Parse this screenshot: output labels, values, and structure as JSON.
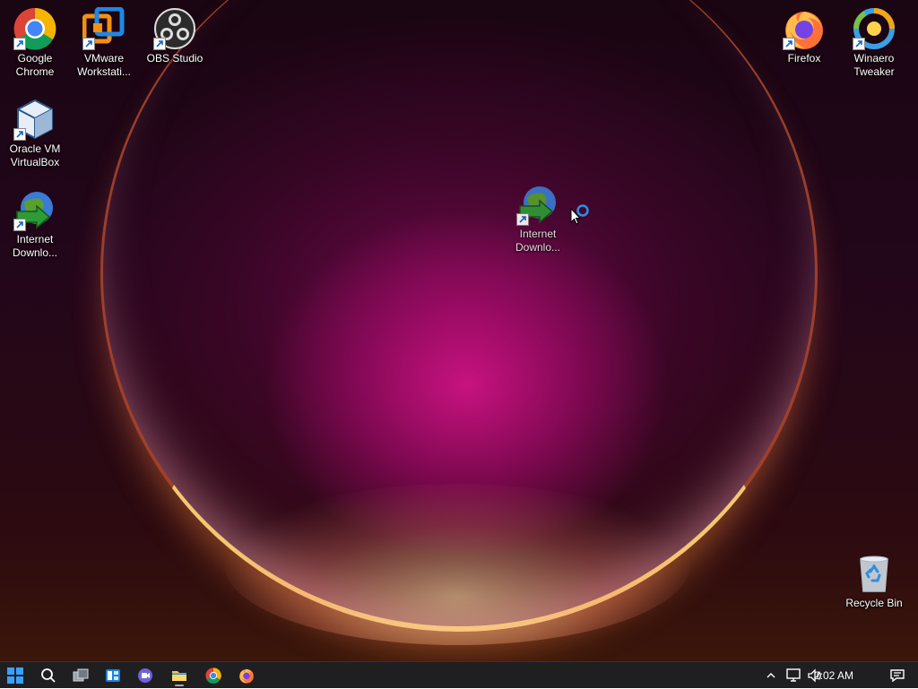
{
  "desktop": {
    "icons": {
      "chrome": {
        "label": "Google Chrome",
        "icon": "chrome-icon"
      },
      "vmware": {
        "label": "VMware Workstati...",
        "icon": "vmware-icon"
      },
      "obs": {
        "label": "OBS Studio",
        "icon": "obs-icon"
      },
      "virtualbox": {
        "label": "Oracle VM VirtualBox",
        "icon": "virtualbox-icon"
      },
      "idm_left": {
        "label": "Internet Downlo...",
        "icon": "idm-icon"
      },
      "idm_dragged": {
        "label": "Internet Downlo...",
        "icon": "idm-icon"
      },
      "firefox": {
        "label": "Firefox",
        "icon": "firefox-icon"
      },
      "winaero": {
        "label": "Winaero Tweaker",
        "icon": "winaero-icon"
      },
      "recycle": {
        "label": "Recycle Bin",
        "icon": "recycle-bin-icon"
      }
    }
  },
  "taskbar": {
    "clock": "2:02 AM",
    "pinned": [
      "start",
      "search",
      "task-view",
      "widgets",
      "chat",
      "file-explorer",
      "chrome",
      "firefox"
    ],
    "colors": {
      "background": "#1f1f22",
      "accent": "#0078d4"
    }
  }
}
